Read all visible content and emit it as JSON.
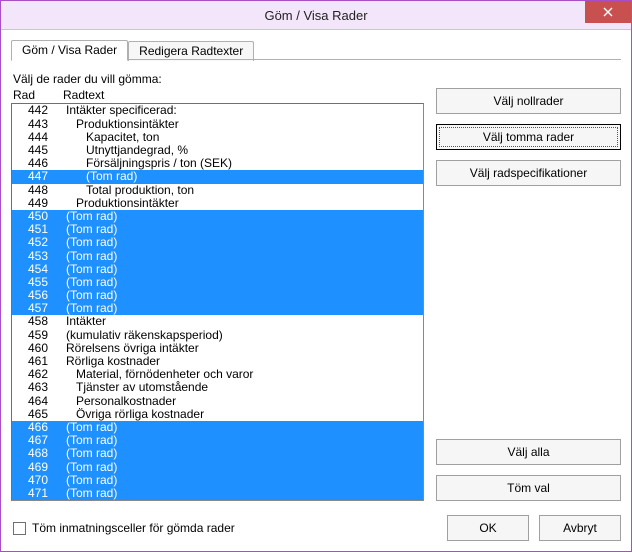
{
  "window": {
    "title": "Göm / Visa Rader"
  },
  "tabs": [
    {
      "label": "Göm / Visa Rader"
    },
    {
      "label": "Redigera Radtexter"
    }
  ],
  "instruction": "Välj de rader du vill gömma:",
  "list": {
    "header_row": "Rad",
    "header_text": "Radtext",
    "rows": [
      {
        "num": "442",
        "text": "Intäkter specificerad:",
        "indent": 1,
        "selected": false
      },
      {
        "num": "443",
        "text": "Produktionsintäkter",
        "indent": 2,
        "selected": false
      },
      {
        "num": "444",
        "text": "Kapacitet, ton",
        "indent": 3,
        "selected": false
      },
      {
        "num": "445",
        "text": "Utnyttjandegrad, %",
        "indent": 3,
        "selected": false
      },
      {
        "num": "446",
        "text": "Försäljningspris / ton (SEK)",
        "indent": 3,
        "selected": false
      },
      {
        "num": "447",
        "text": "(Tom rad)",
        "indent": 3,
        "selected": true
      },
      {
        "num": "448",
        "text": "Total produktion, ton",
        "indent": 3,
        "selected": false
      },
      {
        "num": "449",
        "text": "Produktionsintäkter",
        "indent": 2,
        "selected": false
      },
      {
        "num": "450",
        "text": "(Tom rad)",
        "indent": 1,
        "selected": true
      },
      {
        "num": "451",
        "text": "(Tom rad)",
        "indent": 1,
        "selected": true
      },
      {
        "num": "452",
        "text": "(Tom rad)",
        "indent": 1,
        "selected": true
      },
      {
        "num": "453",
        "text": "(Tom rad)",
        "indent": 1,
        "selected": true
      },
      {
        "num": "454",
        "text": "(Tom rad)",
        "indent": 1,
        "selected": true
      },
      {
        "num": "455",
        "text": "(Tom rad)",
        "indent": 1,
        "selected": true
      },
      {
        "num": "456",
        "text": "(Tom rad)",
        "indent": 1,
        "selected": true
      },
      {
        "num": "457",
        "text": "(Tom rad)",
        "indent": 1,
        "selected": true
      },
      {
        "num": "458",
        "text": "Intäkter",
        "indent": 1,
        "selected": false
      },
      {
        "num": "459",
        "text": "(kumulativ räkenskapsperiod)",
        "indent": 1,
        "selected": false
      },
      {
        "num": "460",
        "text": "Rörelsens övriga intäkter",
        "indent": 1,
        "selected": false
      },
      {
        "num": "461",
        "text": "Rörliga kostnader",
        "indent": 1,
        "selected": false
      },
      {
        "num": "462",
        "text": "Material, förnödenheter och varor",
        "indent": 2,
        "selected": false
      },
      {
        "num": "463",
        "text": "Tjänster av utomstående",
        "indent": 2,
        "selected": false
      },
      {
        "num": "464",
        "text": "Personalkostnader",
        "indent": 2,
        "selected": false
      },
      {
        "num": "465",
        "text": "Övriga rörliga kostnader",
        "indent": 2,
        "selected": false
      },
      {
        "num": "466",
        "text": "(Tom rad)",
        "indent": 1,
        "selected": true
      },
      {
        "num": "467",
        "text": "(Tom rad)",
        "indent": 1,
        "selected": true
      },
      {
        "num": "468",
        "text": "(Tom rad)",
        "indent": 1,
        "selected": true
      },
      {
        "num": "469",
        "text": "(Tom rad)",
        "indent": 1,
        "selected": true
      },
      {
        "num": "470",
        "text": "(Tom rad)",
        "indent": 1,
        "selected": true
      },
      {
        "num": "471",
        "text": "(Tom rad)",
        "indent": 1,
        "selected": true
      }
    ]
  },
  "buttons": {
    "select_zero_rows": "Välj nollrader",
    "select_empty_rows": "Välj tomma rader",
    "select_row_specs": "Välj radspecifikationer",
    "select_all": "Välj alla",
    "clear_selection": "Töm val",
    "ok": "OK",
    "cancel": "Avbryt"
  },
  "checkbox": {
    "label": "Töm inmatningsceller för gömda rader",
    "checked": false
  },
  "colors": {
    "selection": "#1e90ff",
    "titlebar": "#f3e6fa",
    "border": "#a84fc7",
    "close": "#c8504f"
  }
}
